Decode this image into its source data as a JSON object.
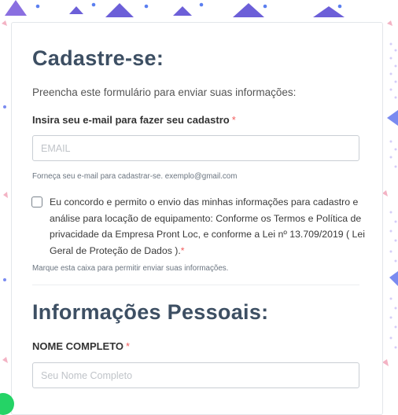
{
  "form": {
    "title": "Cadastre-se:",
    "intro": "Preencha este formulário para enviar suas informações:",
    "email": {
      "label": "Insira seu e-mail para fazer seu cadastro",
      "required_mark": "*",
      "placeholder": "EMAIL",
      "value": "",
      "help": "Forneça seu e-mail para cadastrar-se. exemplo@gmail.com"
    },
    "consent": {
      "checked": false,
      "text": "Eu concordo e permito o envio das minhas informações para cadastro e análise para locação de equipamento: Conforme os Termos e Política de privacidade da Empresa Pront Loc, e conforme a Lei nº 13.709/2019 ( Lei Geral de Proteção de Dados ).",
      "required_mark": "*",
      "help": "Marque esta caixa para permitir enviar suas informações."
    },
    "personal_section_title": "Informações Pessoais:",
    "name": {
      "label": "NOME COMPLETO",
      "required_mark": "*",
      "placeholder": "Seu Nome Completo",
      "value": ""
    }
  },
  "colors": {
    "heading": "#3d4f63",
    "required": "#f25c5c",
    "decor_purple": "#9a86e8",
    "decor_blue": "#6f72e6",
    "chat_button": "#25d366"
  },
  "icons": [
    "checkbox-icon",
    "chat-bubble-icon"
  ]
}
